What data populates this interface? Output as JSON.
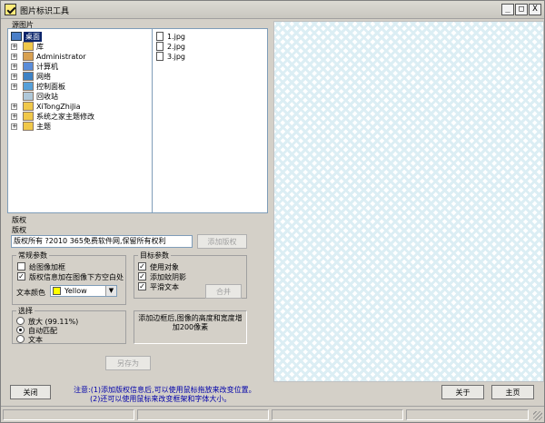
{
  "window": {
    "title": "图片标识工具",
    "minimize": "_",
    "maximize": "□",
    "close": "X"
  },
  "source": {
    "section_label": "源图片",
    "tree": [
      {
        "label": "桌面",
        "icon": "desktop-icon",
        "expander": "",
        "selected": true
      },
      {
        "label": "库",
        "icon": "library-folder-icon",
        "expander": "+"
      },
      {
        "label": "Administrator",
        "icon": "user-icon",
        "expander": "+"
      },
      {
        "label": "计算机",
        "icon": "computer-icon",
        "expander": "+"
      },
      {
        "label": "网络",
        "icon": "network-icon",
        "expander": "+"
      },
      {
        "label": "控制面板",
        "icon": "control-panel-icon",
        "expander": "+"
      },
      {
        "label": "回收站",
        "icon": "recycle-bin-icon",
        "expander": ""
      },
      {
        "label": "XiTongZhiJia",
        "icon": "folder-icon",
        "expander": "+"
      },
      {
        "label": "系统之家主题修改",
        "icon": "folder-icon",
        "expander": "+"
      },
      {
        "label": "主题",
        "icon": "folder-icon",
        "expander": "+"
      }
    ],
    "files": [
      "1.jpg",
      "2.jpg",
      "3.jpg"
    ]
  },
  "copyright": {
    "section_label": "版权",
    "sub_label": "版权",
    "input_value": "版权所有 ?2010 365免费软件网,保留所有权利",
    "add_button": "添加版权"
  },
  "general": {
    "title": "常规参数",
    "opt1": "给图像加框",
    "opt1_checked": false,
    "opt2": "版权信息加在图像下方空白处",
    "opt2_checked": true,
    "text_color_label": "文本颜色",
    "text_color_value": "Yellow",
    "text_color_swatch": "#ffff00"
  },
  "target": {
    "title": "目标参数",
    "opt1": "使用对象",
    "opt1_checked": true,
    "opt2": "添加蚊阴影",
    "opt2_checked": true,
    "opt3": "平滑文本",
    "opt3_checked": true,
    "merge_button": "合并"
  },
  "select": {
    "title": "选择",
    "opt1": "放大 (99.11%)",
    "opt2": "自动匹配",
    "opt3": "文本",
    "selected": 2
  },
  "info_text": "添加边框后,图像的高度和宽度增加200像素",
  "save_as_button": "另存为",
  "bottom": {
    "close_button": "关闭",
    "note_line1": "注意:(1)添加版权信息后,可以使用鼠标拖放来改变位置。",
    "note_line2": "(2)还可以使用鼠标来改变框架和字体大小。",
    "about_button": "关于",
    "home_button": "主页",
    "accent_color": "#0000aa"
  }
}
